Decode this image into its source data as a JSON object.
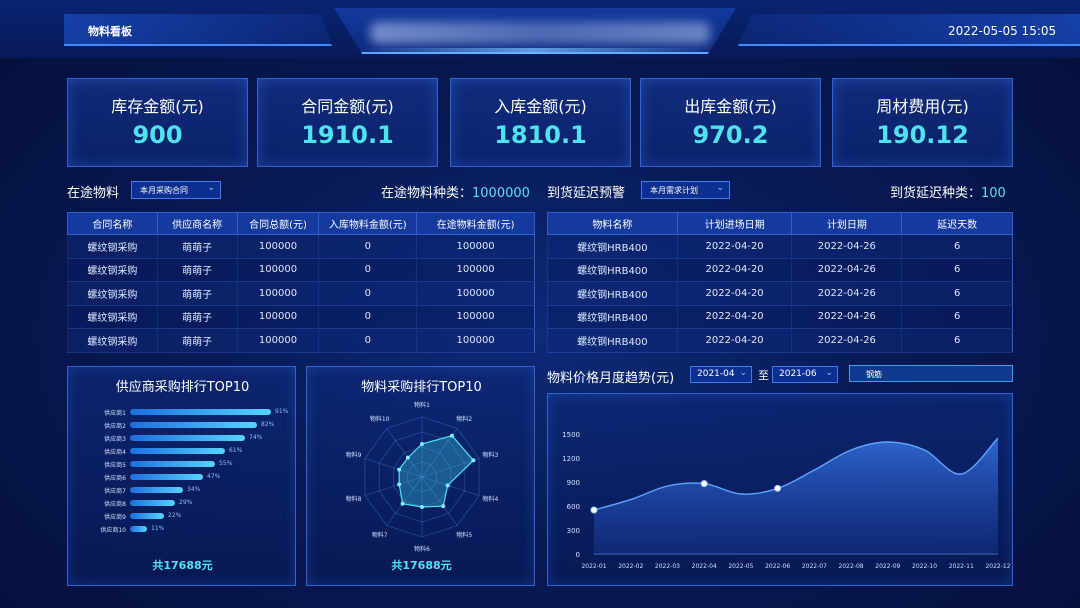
{
  "header": {
    "app_title": "物料看板",
    "datetime": "2022-05-05 15:05"
  },
  "stats": [
    {
      "label": "库存金额(元)",
      "value": "900"
    },
    {
      "label": "合同金额(元)",
      "value": "1910.1"
    },
    {
      "label": "入库金额(元)",
      "value": "1810.1"
    },
    {
      "label": "出库金额(元)",
      "value": "970.2"
    },
    {
      "label": "周材费用(元)",
      "value": "190.12"
    }
  ],
  "in_transit": {
    "title": "在途物料",
    "filter": "本月采购合同",
    "count_label": "在途物料种类：",
    "count_value": "1000000",
    "columns": [
      "合同名称",
      "供应商名称",
      "合同总额(元)",
      "入库物料金额(元)",
      "在途物料金额(元)"
    ],
    "rows": [
      [
        "螺纹钢采购",
        "萌萌子",
        "100000",
        "0",
        "100000"
      ],
      [
        "螺纹钢采购",
        "萌萌子",
        "100000",
        "0",
        "100000"
      ],
      [
        "螺纹钢采购",
        "萌萌子",
        "100000",
        "0",
        "100000"
      ],
      [
        "螺纹钢采购",
        "萌萌子",
        "100000",
        "0",
        "100000"
      ],
      [
        "螺纹钢采购",
        "萌萌子",
        "100000",
        "0",
        "100000"
      ]
    ]
  },
  "delay_warning": {
    "title": "到货延迟预警",
    "filter": "本月需求计划",
    "count_label": "到货延迟种类：",
    "count_value": "100",
    "columns": [
      "物料名称",
      "计划进场日期",
      "计划日期",
      "延迟天数"
    ],
    "rows": [
      [
        "螺纹钢HRB400",
        "2022-04-20",
        "2022-04-26",
        "6"
      ],
      [
        "螺纹钢HRB400",
        "2022-04-20",
        "2022-04-26",
        "6"
      ],
      [
        "螺纹钢HRB400",
        "2022-04-20",
        "2022-04-26",
        "6"
      ],
      [
        "螺纹钢HRB400",
        "2022-04-20",
        "2022-04-26",
        "6"
      ],
      [
        "螺纹钢HRB400",
        "2022-04-20",
        "2022-04-26",
        "6"
      ]
    ]
  },
  "supplier_rank": {
    "title": "供应商采购排行TOP10",
    "total": "共17688元",
    "items": [
      {
        "label": "供应商1",
        "pct": 91,
        "pct_text": "91%"
      },
      {
        "label": "供应商2",
        "pct": 82,
        "pct_text": "82%"
      },
      {
        "label": "供应商3",
        "pct": 74,
        "pct_text": "74%"
      },
      {
        "label": "供应商4",
        "pct": 61,
        "pct_text": "61%"
      },
      {
        "label": "供应商5",
        "pct": 55,
        "pct_text": "55%"
      },
      {
        "label": "供应商6",
        "pct": 47,
        "pct_text": "47%"
      },
      {
        "label": "供应商7",
        "pct": 34,
        "pct_text": "34%"
      },
      {
        "label": "供应商8",
        "pct": 29,
        "pct_text": "29%"
      },
      {
        "label": "供应商9",
        "pct": 22,
        "pct_text": "22%"
      },
      {
        "label": "供应商10",
        "pct": 11,
        "pct_text": "11%"
      }
    ]
  },
  "material_rank": {
    "title": "物料采购排行TOP10",
    "total": "共17688元",
    "labels": [
      "物料1",
      "物料2",
      "物料3",
      "物料4",
      "物料5",
      "物料6",
      "物料7",
      "物料8",
      "物料9",
      "物料10"
    ],
    "values": [
      0.55,
      0.85,
      0.9,
      0.45,
      0.6,
      0.5,
      0.55,
      0.4,
      0.4,
      0.4
    ]
  },
  "price_trend": {
    "title": "物料价格月度趋势(元)",
    "from": "2021-04",
    "to_label": "至",
    "to": "2021-06",
    "material": "钢筋"
  },
  "chart_data": {
    "type": "area",
    "x": [
      "2022-01",
      "2022-02",
      "2022-03",
      "2022-04",
      "2022-05",
      "2022-06",
      "2022-07",
      "2022-08",
      "2022-09",
      "2022-10",
      "2022-11",
      "2022-12"
    ],
    "y": [
      550,
      680,
      850,
      880,
      750,
      820,
      1050,
      1300,
      1400,
      1300,
      1000,
      1450
    ],
    "highlight_x": [
      "2022-01",
      "2022-04",
      "2022-06"
    ],
    "yticks": [
      0,
      300,
      600,
      900,
      1200,
      1500
    ],
    "ylim": [
      0,
      1650
    ],
    "grid": false,
    "colors": {
      "line": "#5aa8ff",
      "fill": "#2d6ee8"
    }
  },
  "colors": {
    "accent": "#4ee3ef",
    "panel_border": "#2f62d8",
    "background": "#081a55"
  }
}
